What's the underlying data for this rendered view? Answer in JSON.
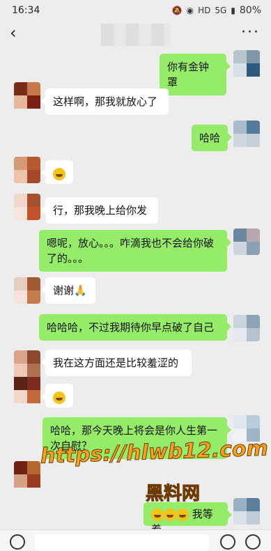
{
  "status": {
    "time": "16:34",
    "battery": "80%",
    "hd": "HD",
    "net": "5G"
  },
  "nav": {
    "back": "‹",
    "more": "···"
  },
  "messages": [
    {
      "side": "out",
      "text": "你有金钟罩"
    },
    {
      "side": "in",
      "text": "这样啊，那我就放心了"
    },
    {
      "side": "out",
      "text": "哈哈"
    },
    {
      "side": "in",
      "text": ""
    },
    {
      "side": "in",
      "text": "行，那我晚上给你发"
    },
    {
      "side": "out",
      "text": "嗯呢，放心。。。咋滴我也不会给你破了的。。。"
    },
    {
      "side": "in",
      "text": "谢谢🙏"
    },
    {
      "side": "out",
      "text": "哈哈哈，不过我期待你早点破了自己"
    },
    {
      "side": "in",
      "text": "我在这方面还是比较羞涩的"
    },
    {
      "side": "in",
      "text": ""
    },
    {
      "side": "out",
      "text": "哈哈，那今天晚上将会是你人生第一次自慰？"
    },
    {
      "side": "out",
      "text": "我等着"
    }
  ],
  "watermark": {
    "url": "https://hlwb12.com",
    "name": "黑料网"
  }
}
